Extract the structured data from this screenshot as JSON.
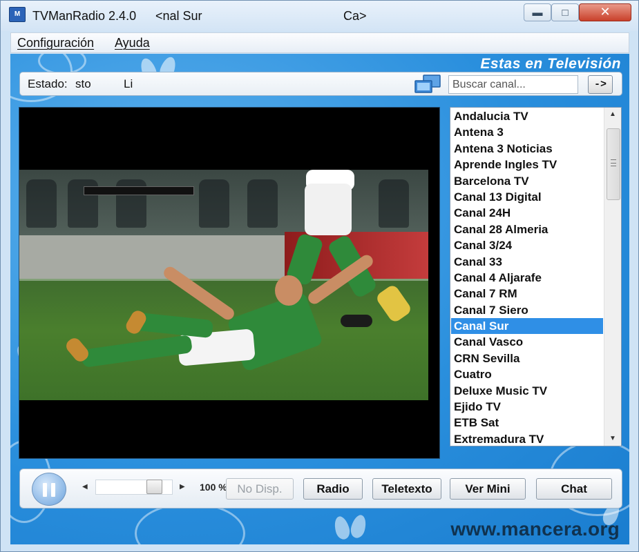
{
  "window": {
    "app_title": "TVManRadio 2.4.0",
    "title_channel": "<nal Sur",
    "title_extra": "Ca>",
    "icon": "tvmanradio-app-icon",
    "controls": {
      "minimize": "minimize-icon",
      "maximize": "maximize-icon",
      "close": "close-icon"
    }
  },
  "menu": {
    "items": [
      {
        "label": "Configuración"
      },
      {
        "label": "Ayuda"
      }
    ]
  },
  "header": {
    "banner": "Estas en Televisión"
  },
  "status": {
    "label": "Estado:",
    "value": "sto",
    "extra": "Li"
  },
  "search": {
    "placeholder": "Buscar canal...",
    "go_label": "->"
  },
  "channels": {
    "items": [
      "Andalucia TV",
      "Antena 3",
      "Antena 3 Noticias",
      "Aprende Ingles TV",
      "Barcelona TV",
      "Canal 13 Digital",
      "Canal 24H",
      "Canal 28 Almeria",
      "Canal 3/24",
      "Canal 33",
      "Canal 4 Aljarafe",
      "Canal 7 RM",
      "Canal 7 Siero",
      "Canal Sur",
      "Canal Vasco",
      "CRN Sevilla",
      "Cuatro",
      "Deluxe Music TV",
      "Ejido TV",
      "ETB Sat",
      "Extremadura TV"
    ],
    "selected": "Canal Sur",
    "selected_color": "#2f8fe6"
  },
  "controls": {
    "volume_percent": "100 %",
    "volume_level": 0.85,
    "buttons": {
      "no_disp": "No Disp.",
      "radio": "Radio",
      "teletexto": "Teletexto",
      "ver_mini": "Ver Mini",
      "chat": "Chat"
    }
  },
  "footer": {
    "website": "www.mancera.org"
  },
  "colors": {
    "background_blue": "#2a8fdd",
    "accent": "#2f8fe6",
    "video_bg": "#000000"
  }
}
